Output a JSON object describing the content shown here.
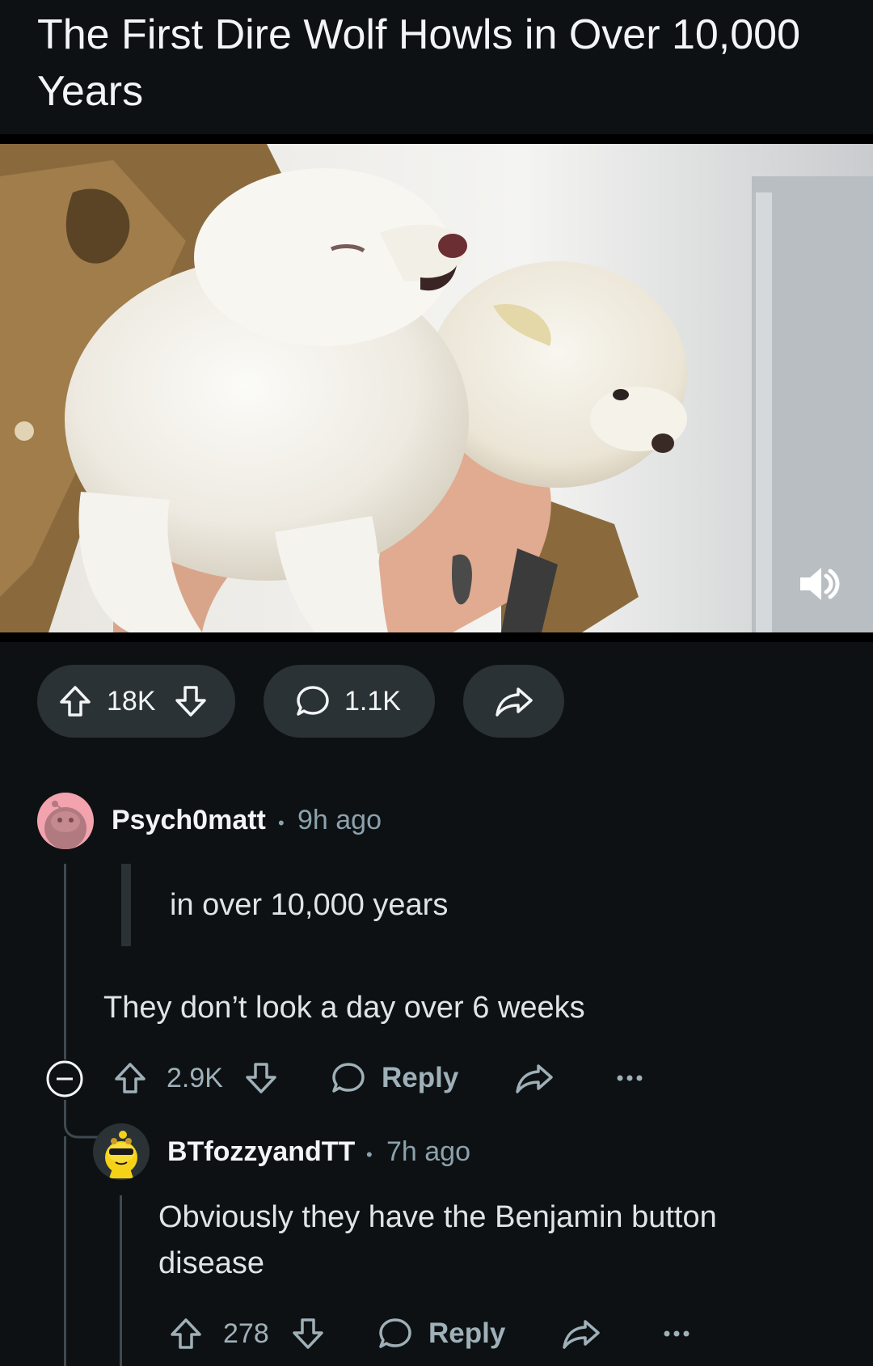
{
  "post": {
    "title": "The First Dire Wolf Howls in Over 10,000 Years",
    "votes": "18K",
    "comments": "1.1K"
  },
  "media": {
    "description_icon": "mute-icon"
  },
  "comments": [
    {
      "username": "Psych0matt",
      "time": "9h ago",
      "quote": "in over 10,000 years",
      "text": "They don’t look a day over 6 weeks",
      "votes": "2.9K",
      "reply_label": "Reply"
    },
    {
      "username": "BTfozzyandTT",
      "time": "7h ago",
      "text_line1": "Obviously they have the Benjamin button",
      "text_line2": "disease",
      "votes": "278",
      "reply_label": "Reply"
    }
  ],
  "colors": {
    "background": "#0e1113",
    "pill": "#2a3236",
    "meta": "#9eb0b8",
    "avatar1": "#f3a3ad",
    "avatar2": "#2a3236"
  }
}
